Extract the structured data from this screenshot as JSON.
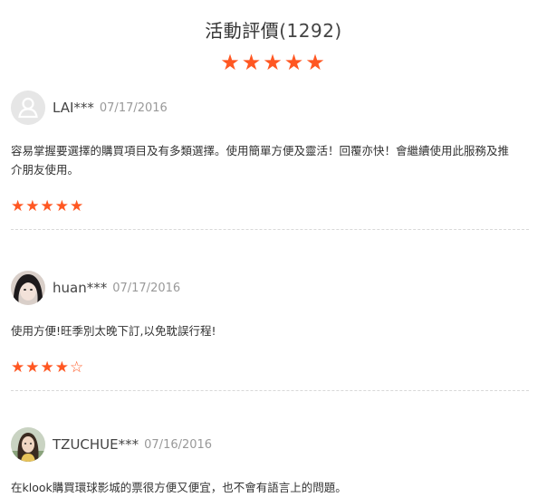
{
  "header": {
    "title": "活動評價",
    "count": "(1292)",
    "stars": "★★★★★"
  },
  "reviews": [
    {
      "username": "LAI***",
      "date": "07/17/2016",
      "text": "容易掌握要選擇的購買項目及有多類選擇。使用簡單方便及靈活！回覆亦快！會繼續使用此服務及推介朋友使用。",
      "stars": "★★★★★",
      "rating": 5,
      "avatar_icon": "default-user-icon"
    },
    {
      "username": "huan***",
      "date": "07/17/2016",
      "text": "使用方便!旺季別太晚下訂,以免耽誤行程!",
      "stars": "★★★★☆",
      "rating": 4,
      "avatar_icon": "user-photo"
    },
    {
      "username": "TZUCHUE***",
      "date": "07/16/2016",
      "text": "在klook購買環球影城的票很方便又便宜，也不會有語言上的問題。",
      "avatar_icon": "user-photo"
    }
  ],
  "colors": {
    "star": "#ff5722",
    "date": "#999999",
    "divider": "#d8d8d8"
  }
}
